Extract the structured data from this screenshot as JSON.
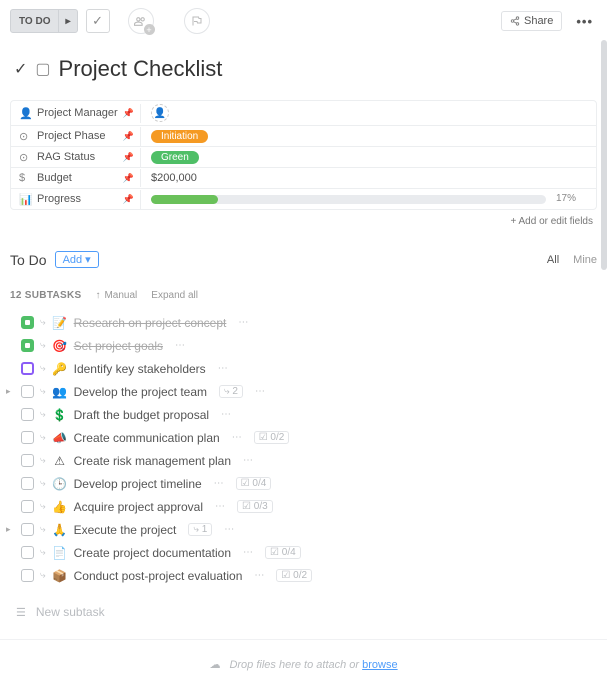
{
  "toolbar": {
    "status": "TO DO",
    "share": "Share"
  },
  "title": "Project Checklist",
  "fields": [
    {
      "icon": "👤",
      "label": "Project Manager",
      "type": "assignee"
    },
    {
      "icon": "⊙",
      "label": "Project Phase",
      "type": "tag",
      "value": "Initiation",
      "tagColor": "orange"
    },
    {
      "icon": "⊙",
      "label": "RAG Status",
      "type": "tag",
      "value": "Green",
      "tagColor": "green"
    },
    {
      "icon": "$",
      "label": "Budget",
      "type": "text",
      "value": "$200,000"
    },
    {
      "icon": "📊",
      "label": "Progress",
      "type": "progress",
      "pct": 17
    }
  ],
  "add_fields": "+ Add or edit fields",
  "section": {
    "title": "To Do",
    "add": "Add",
    "filters": {
      "all": "All",
      "mine": "Mine"
    }
  },
  "subtasks_bar": {
    "count": "12 SUBTASKS",
    "manual": "Manual",
    "expand": "Expand all"
  },
  "tasks": [
    {
      "check": "green",
      "emoji": "📝",
      "name": "Research on project concept",
      "done": true,
      "expandable": false
    },
    {
      "check": "green",
      "emoji": "🎯",
      "name": "Set project goals",
      "done": true,
      "expandable": false
    },
    {
      "check": "purple",
      "emoji": "🔑",
      "name": "Identify key stakeholders",
      "expandable": false
    },
    {
      "check": "",
      "emoji": "👥",
      "name": "Develop the project team",
      "expandable": true,
      "sub": "2"
    },
    {
      "check": "",
      "emoji": "💲",
      "name": "Draft the budget proposal",
      "expandable": false
    },
    {
      "check": "",
      "emoji": "📣",
      "name": "Create communication plan",
      "expandable": false,
      "cl": "0/2"
    },
    {
      "check": "",
      "emoji": "⚠",
      "name": "Create risk management plan",
      "expandable": false
    },
    {
      "check": "",
      "emoji": "🕒",
      "name": "Develop project timeline",
      "expandable": false,
      "cl": "0/4"
    },
    {
      "check": "",
      "emoji": "👍",
      "name": "Acquire project approval",
      "expandable": false,
      "cl": "0/3"
    },
    {
      "check": "",
      "emoji": "🙏",
      "name": "Execute the project",
      "expandable": true,
      "sub": "1"
    },
    {
      "check": "",
      "emoji": "📄",
      "name": "Create project documentation",
      "expandable": false,
      "cl": "0/4"
    },
    {
      "check": "",
      "emoji": "📦",
      "name": "Conduct post-project evaluation",
      "expandable": false,
      "cl": "0/2"
    }
  ],
  "new_subtask": "New subtask",
  "drop_zone": {
    "text": "Drop files here to attach or ",
    "link": "browse"
  }
}
